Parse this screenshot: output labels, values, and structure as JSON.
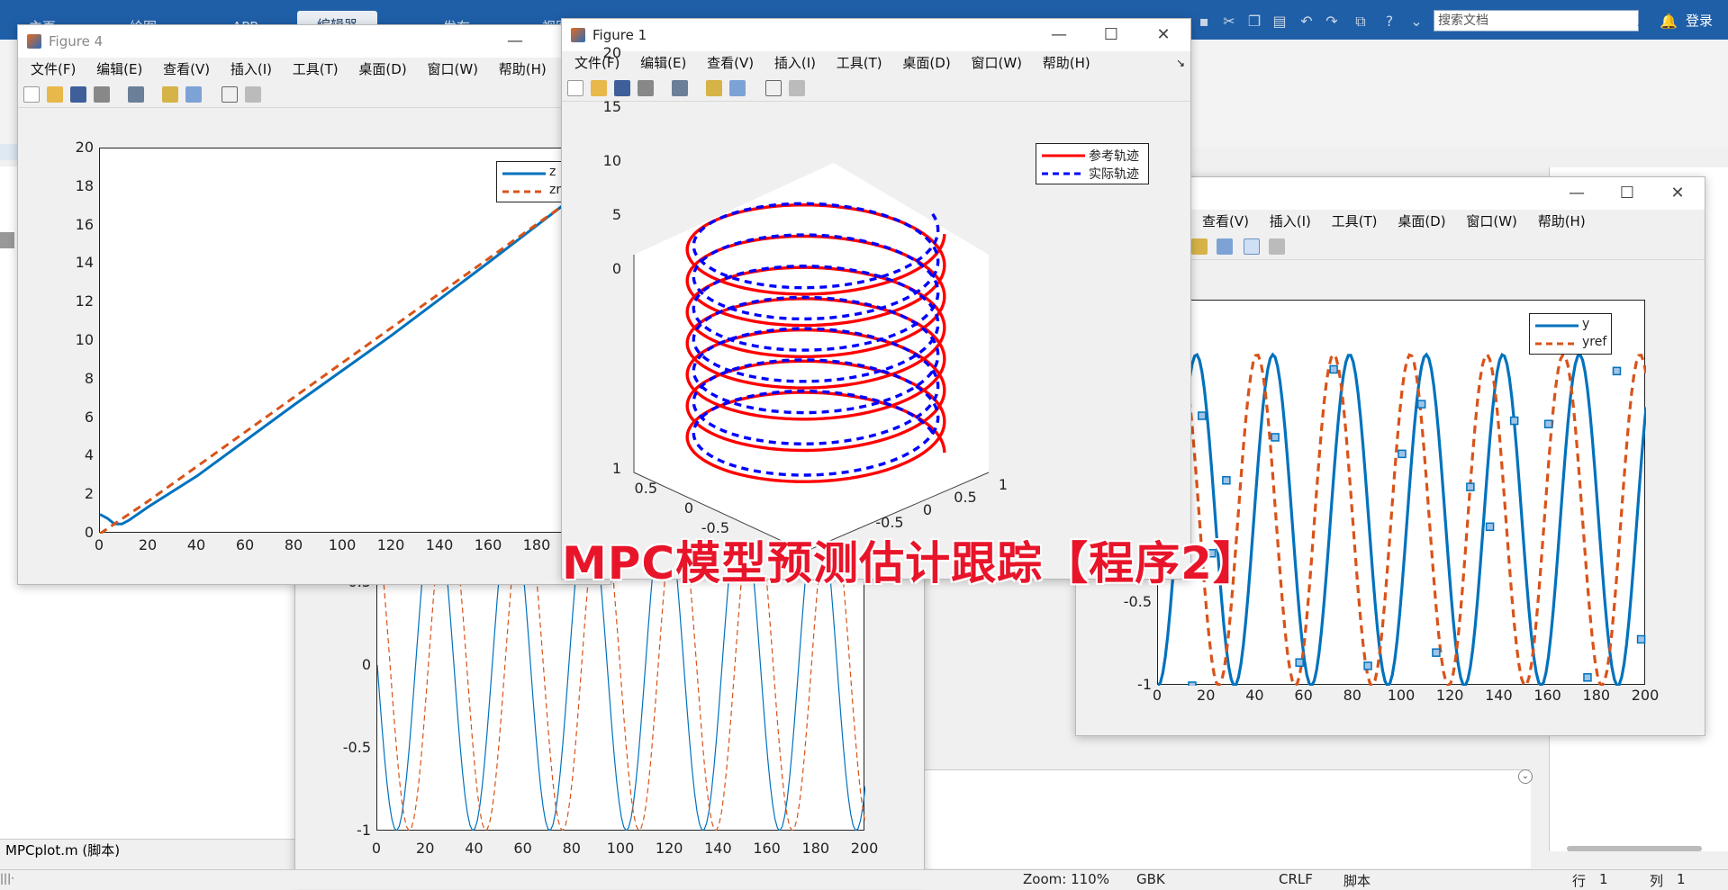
{
  "ribbon": {
    "tabs": [
      "主页",
      "绘图",
      "APP",
      "编辑器",
      "发布",
      "视图"
    ],
    "search_placeholder": "搜索文档",
    "login_label": "登录"
  },
  "editor_left": {
    "bottom_label": "MPCplot.m  (脚本)"
  },
  "status": {
    "zoom": "Zoom: 110%",
    "encoding": "GBK",
    "line_end": "CRLF",
    "file_type": "脚本",
    "row_label": "行",
    "row_value": "1",
    "col_label": "列",
    "col_value": "1"
  },
  "menu_labels": [
    "文件(F)",
    "编辑(E)",
    "查看(V)",
    "插入(I)",
    "工具(T)",
    "桌面(D)",
    "窗口(W)",
    "帮助(H)"
  ],
  "menu_labels_partial": [
    "查看(V)",
    "插入(I)",
    "工具(T)",
    "桌面(D)",
    "窗口(W)",
    "帮助(H)"
  ],
  "figure4": {
    "title": "Figure 4",
    "chart_data": {
      "type": "line",
      "xlim": [
        0,
        200
      ],
      "ylim": [
        0,
        20
      ],
      "xticks": [
        "0",
        "20",
        "40",
        "60",
        "80",
        "100",
        "120",
        "140",
        "160",
        "180"
      ],
      "yticks": [
        "0",
        "2",
        "4",
        "6",
        "8",
        "10",
        "12",
        "14",
        "16",
        "18",
        "20"
      ],
      "series": [
        {
          "name": "z",
          "style": "solid",
          "color": "#0072bd",
          "x": [
            0,
            3,
            6,
            9,
            12,
            20,
            40,
            80,
            120,
            160,
            190
          ],
          "y": [
            1.0,
            0.8,
            0.5,
            0.5,
            0.7,
            1.4,
            3.0,
            6.7,
            10.3,
            14.1,
            17.0
          ]
        },
        {
          "name": "zr",
          "style": "dashed",
          "color": "#d95319",
          "x": [
            0,
            20,
            40,
            80,
            120,
            160,
            190
          ],
          "y": [
            0,
            1.7,
            3.5,
            7.1,
            10.7,
            14.3,
            17.0
          ]
        }
      ]
    }
  },
  "figure1": {
    "title": "Figure 1",
    "chart_data": {
      "type": "line",
      "zticks": [
        "0",
        "5",
        "10",
        "15",
        "20"
      ],
      "yticks_left": [
        "1",
        "0.5",
        "0",
        "-0.5"
      ],
      "xticks_right": [
        "1",
        "0.5",
        "0",
        "-0.5"
      ],
      "series": [
        {
          "name": "参考轨迹",
          "style": "solid",
          "color": "#ff0000"
        },
        {
          "name": "实际轨迹",
          "style": "dashed",
          "color": "#0000ff"
        }
      ],
      "turns": 7
    }
  },
  "figure_right": {
    "chart_data": {
      "type": "line",
      "xlim": [
        0,
        200
      ],
      "ylim": [
        -1,
        1
      ],
      "xticks": [
        "0",
        "20",
        "40",
        "60",
        "80",
        "100",
        "120",
        "140",
        "160",
        "180",
        "200"
      ],
      "yticks": [
        "-1",
        "-0.5"
      ],
      "series": [
        {
          "name": "y",
          "style": "solid",
          "color": "#0072bd",
          "period": 31.4,
          "phase_deg": -90
        },
        {
          "name": "yref",
          "style": "dashed",
          "color": "#d95319",
          "period": 31.4,
          "phase_deg": -15
        }
      ]
    }
  },
  "figure_bottom": {
    "chart_data": {
      "type": "line",
      "xlim": [
        0,
        200
      ],
      "ylim": [
        -1,
        1
      ],
      "xticks": [
        "0",
        "20",
        "40",
        "60",
        "80",
        "100",
        "120",
        "140",
        "160",
        "180",
        "200"
      ],
      "yticks": [
        "-1",
        "-0.5",
        "0",
        "0.5"
      ],
      "series": [
        {
          "style": "solid",
          "color": "#0072bd",
          "period": 31.4,
          "phase_deg": 0
        },
        {
          "style": "dashed",
          "color": "#d95319",
          "period": 31.4,
          "phase_deg": 60
        }
      ]
    }
  },
  "banner": "MPC模型预测估计跟踪【程序2】",
  "colors": {
    "ribbon": "#1f5fa8",
    "ref": "#ff0000",
    "actual": "#0000ff",
    "blue_line": "#0072bd",
    "orange_line": "#d95319"
  }
}
